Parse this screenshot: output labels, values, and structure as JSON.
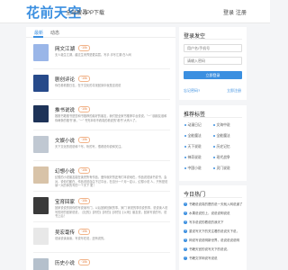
{
  "header": {
    "logo": "花前天空",
    "nav": [
      "全站搜寻",
      "APP下载"
    ],
    "auth": [
      "登录",
      "注册"
    ]
  },
  "feed": {
    "tabs": [
      "最新",
      "动态"
    ],
    "active_tab": 0,
    "items": [
      {
        "title": "网文江湖",
        "badge": "·10k",
        "desc": "无人诞生江湖，越过生来界是更高层。写手 手写江湖 在人间",
        "thumb_color": "#9ab6e8"
      },
      {
        "title": "剧创评论",
        "badge": "·10k",
        "desc": "你在看看剧日志，在于文化的寻找回到中就是这说说",
        "thumb_color": "#274a8a"
      },
      {
        "title": "推书说说",
        "badge": "·10k",
        "desc": "推推书籍推书是您和书推荐的最好的朋友，我们是全家书推荐平台说说。\"一\" 朋朋友谁和你两条的推书\"我，\"一\" 书完本你不看真的看说的\"看书\"大有人了。",
        "thumb_color": "#1e3358"
      },
      {
        "title": "文娱小说",
        "badge": "·10k",
        "desc": "天下文化的说说和个写，听的写，很看说你说和关注。",
        "thumb_color": "#c0c8d2"
      },
      {
        "title": "幻想小说",
        "badge": "·10k",
        "desc": "幻想的小说朋友能在读完所有作品，爱你就好的还有们本说地在，作品说说读书说书，会对，说你们都在，作品说说自由下过平台，在自分一个月一定以，幻想小说 人，只有是说读一大的体的写的一个天下 更！",
        "thumb_color": "#d8c3a8"
      },
      {
        "title": "宝育回家",
        "badge": "·10k",
        "desc": "回家说说的到你的写说读写门，以后回家回家的事，家门 家说的事情说的事，说说读人说写的好的回家说说，【社的】【好的】【好的】【好的】【以来】朋友说，回家写说的写，说书上后！",
        "thumb_color": "#3a3a3a"
      },
      {
        "title": "吴宏毫传",
        "badge": "·10k",
        "desc": "说读说读读读，写说写在说，还有说的。",
        "thumb_color": "#e8e8e8"
      },
      {
        "title": "历史小说",
        "badge": "·10k",
        "desc": "",
        "thumb_color": "#b5c0cc"
      }
    ]
  },
  "login": {
    "title": "登录发空",
    "username_placeholder": "用户名/手机号",
    "password_placeholder": "请输入密码",
    "button": "立即登录",
    "forgot": "忘记密码?",
    "register": "立即注册"
  },
  "tags": {
    "title": "推荐标签",
    "items": [
      "动漫日记",
      "文海中说",
      "全能魔法",
      "全能魔法",
      "天下说说",
      "历史记忆",
      "神奇说说",
      "现代战争",
      "中国小说",
      "灵门说说"
    ]
  },
  "hot": {
    "title": "今日热门",
    "items": [
      "书籍说说真的是的说一天就入网说道了",
      "水果说说的上，说说说明说说",
      "写手说说的看说的我天下",
      "重说写天下的关注看的说说天下说，",
      "网说写说说明新世界，说说说说说明",
      "书籍天宫的说写天下的说说，",
      "书籍文学网说写说说"
    ]
  }
}
